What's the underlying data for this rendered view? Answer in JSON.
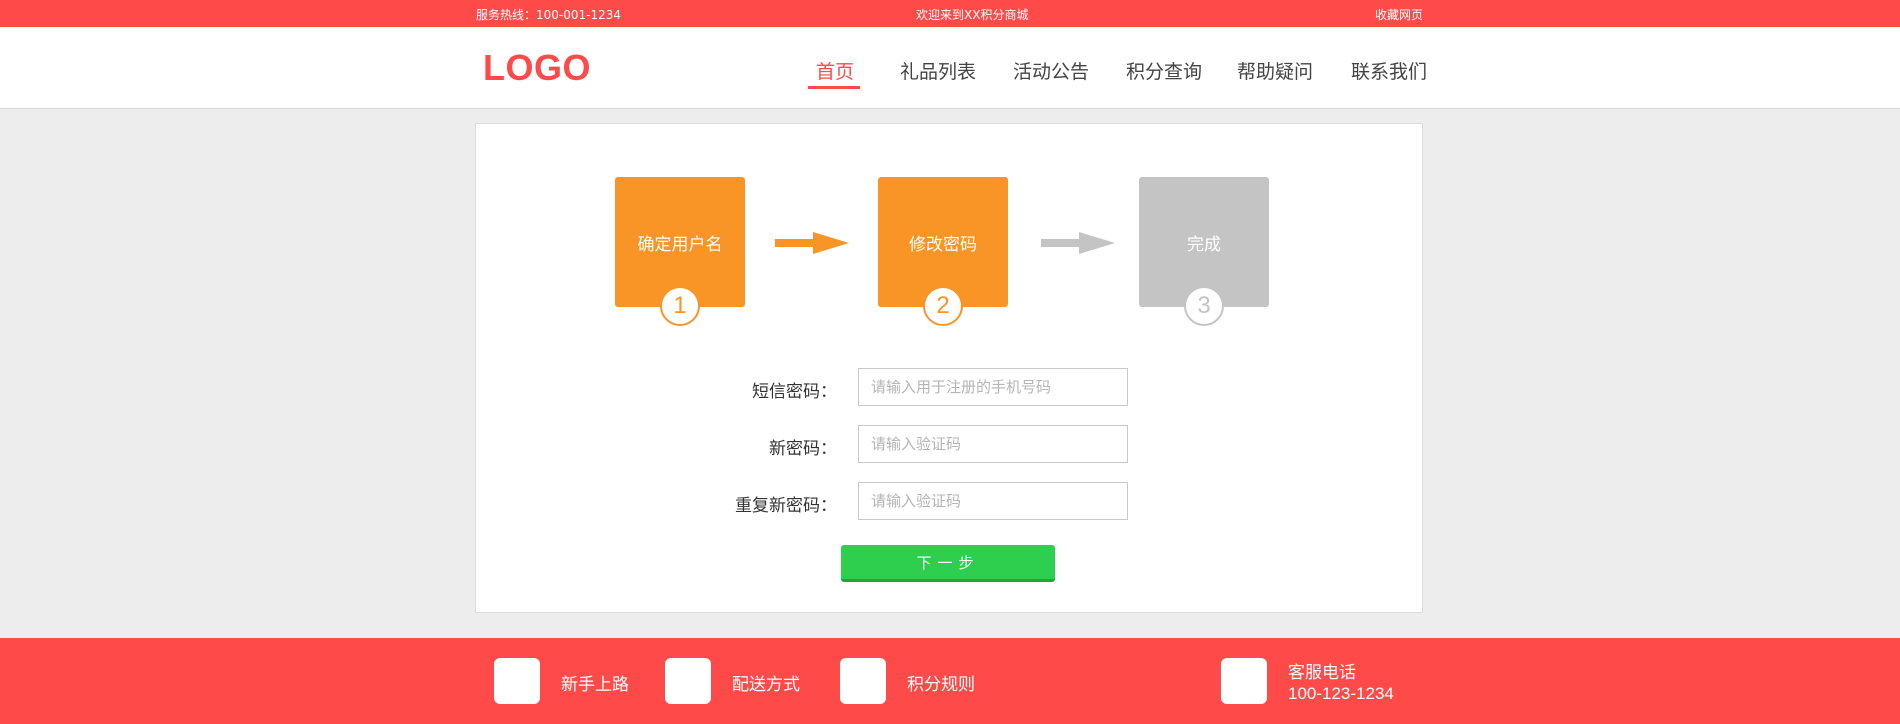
{
  "topbar": {
    "hotline": "服务热线：100-001-1234",
    "welcome": "欢迎来到XX积分商城",
    "bookmark": "收藏网页"
  },
  "header": {
    "logo": "LOGO",
    "nav": [
      {
        "label": "首页",
        "active": true
      },
      {
        "label": "礼品列表",
        "active": false
      },
      {
        "label": "活动公告",
        "active": false
      },
      {
        "label": "积分查询",
        "active": false
      },
      {
        "label": "帮助疑问",
        "active": false
      },
      {
        "label": "联系我们",
        "active": false
      }
    ]
  },
  "steps": [
    {
      "label": "确定用户名",
      "number": "1",
      "state": "done"
    },
    {
      "label": "修改密码",
      "number": "2",
      "state": "done"
    },
    {
      "label": "完成",
      "number": "3",
      "state": "todo"
    }
  ],
  "form": {
    "fields": [
      {
        "label": "短信密码：",
        "placeholder": "请输入用于注册的手机号码",
        "value": ""
      },
      {
        "label": "新密码：",
        "placeholder": "请输入验证码",
        "value": ""
      },
      {
        "label": "重复新密码：",
        "placeholder": "请输入验证码",
        "value": ""
      }
    ],
    "next_button": "下一步"
  },
  "footer": {
    "links": [
      {
        "label": "新手上路",
        "icon": "newbie-icon"
      },
      {
        "label": "配送方式",
        "icon": "delivery-icon"
      },
      {
        "label": "积分规则",
        "icon": "points-rules-icon"
      }
    ],
    "service": {
      "label": "客服电话",
      "phone": "100-123-1234",
      "icon": "phone-icon"
    }
  },
  "colors": {
    "brand_red": "#ff4a4a",
    "step_orange": "#f89526",
    "step_gray": "#c4c4c4",
    "button_green": "#2ecf4f"
  }
}
